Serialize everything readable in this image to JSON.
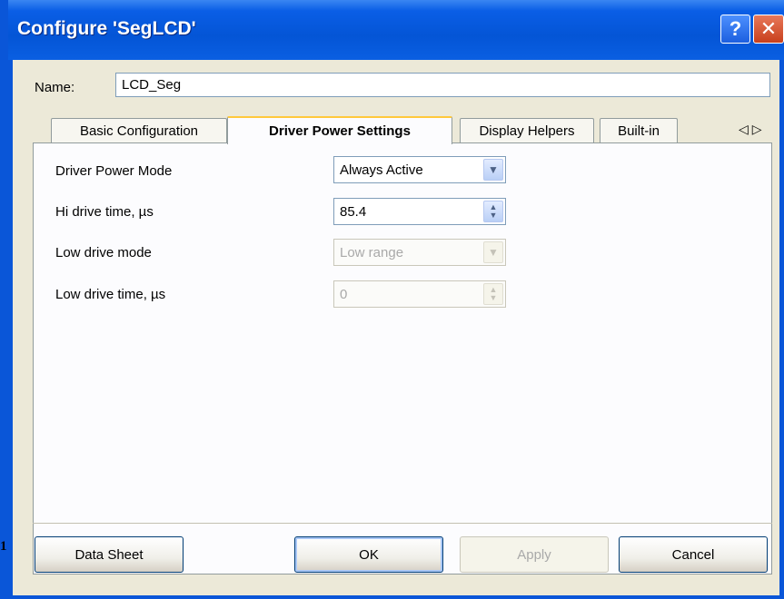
{
  "window": {
    "title": "Configure 'SegLCD'",
    "help_glyph": "?",
    "close_glyph": "✕"
  },
  "name_row": {
    "label": "Name:",
    "value": "LCD_Seg"
  },
  "tabs": [
    {
      "label": "Basic Configuration",
      "active": false
    },
    {
      "label": "Driver Power Settings",
      "active": true
    },
    {
      "label": "Display Helpers",
      "active": false
    },
    {
      "label": "Built-in",
      "active": false
    }
  ],
  "tab_scroll": {
    "left": "◁",
    "right": "▷"
  },
  "fields": {
    "driver_power_mode": {
      "label": "Driver Power Mode",
      "value": "Always Active",
      "enabled": true
    },
    "hi_drive_time": {
      "label": "Hi drive time, µs",
      "value": "85.4",
      "enabled": true
    },
    "low_drive_mode": {
      "label": "Low drive mode",
      "value": "Low range",
      "enabled": false
    },
    "low_drive_time": {
      "label": "Low drive time, µs",
      "value": "0",
      "enabled": false
    }
  },
  "buttons": {
    "data_sheet": "Data Sheet",
    "ok": "OK",
    "apply": "Apply",
    "cancel": "Cancel"
  },
  "edge_glyph": "1",
  "colors": {
    "title_bar": "#0a56d8",
    "client_bg": "#ece9d8",
    "active_tab_accent": "#ffc83c"
  }
}
